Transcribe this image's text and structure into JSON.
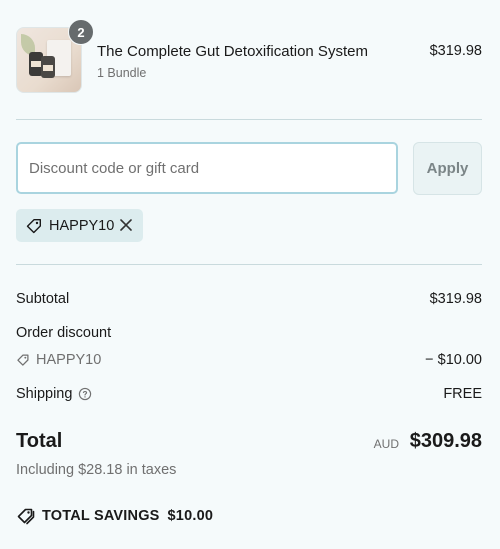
{
  "product": {
    "name": "The Complete Gut Detoxification System",
    "variant": "1 Bundle",
    "price": "$319.98",
    "quantity": "2"
  },
  "discount": {
    "placeholder": "Discount code or gift card",
    "value": "",
    "apply_label": "Apply",
    "applied_code": "HAPPY10"
  },
  "summary": {
    "subtotal_label": "Subtotal",
    "subtotal_value": "$319.98",
    "order_discount_label": "Order discount",
    "discount_code": "HAPPY10",
    "discount_value": "− $10.00",
    "shipping_label": "Shipping",
    "shipping_value": "FREE",
    "total_label": "Total",
    "total_currency": "AUD",
    "total_value": "$309.98",
    "taxes_note": "Including $28.18 in taxes",
    "savings_label": "TOTAL SAVINGS",
    "savings_value": "$10.00"
  },
  "icons": {
    "tag": "tag-icon",
    "remove": "close-icon",
    "help": "question-circle-icon",
    "savings": "double-tag-icon"
  },
  "colors": {
    "background": "#f5fafb",
    "input_border_focus": "#a9d4df",
    "tag_background": "#dcecee",
    "divider": "#c9dadd",
    "muted_text": "#707070"
  }
}
